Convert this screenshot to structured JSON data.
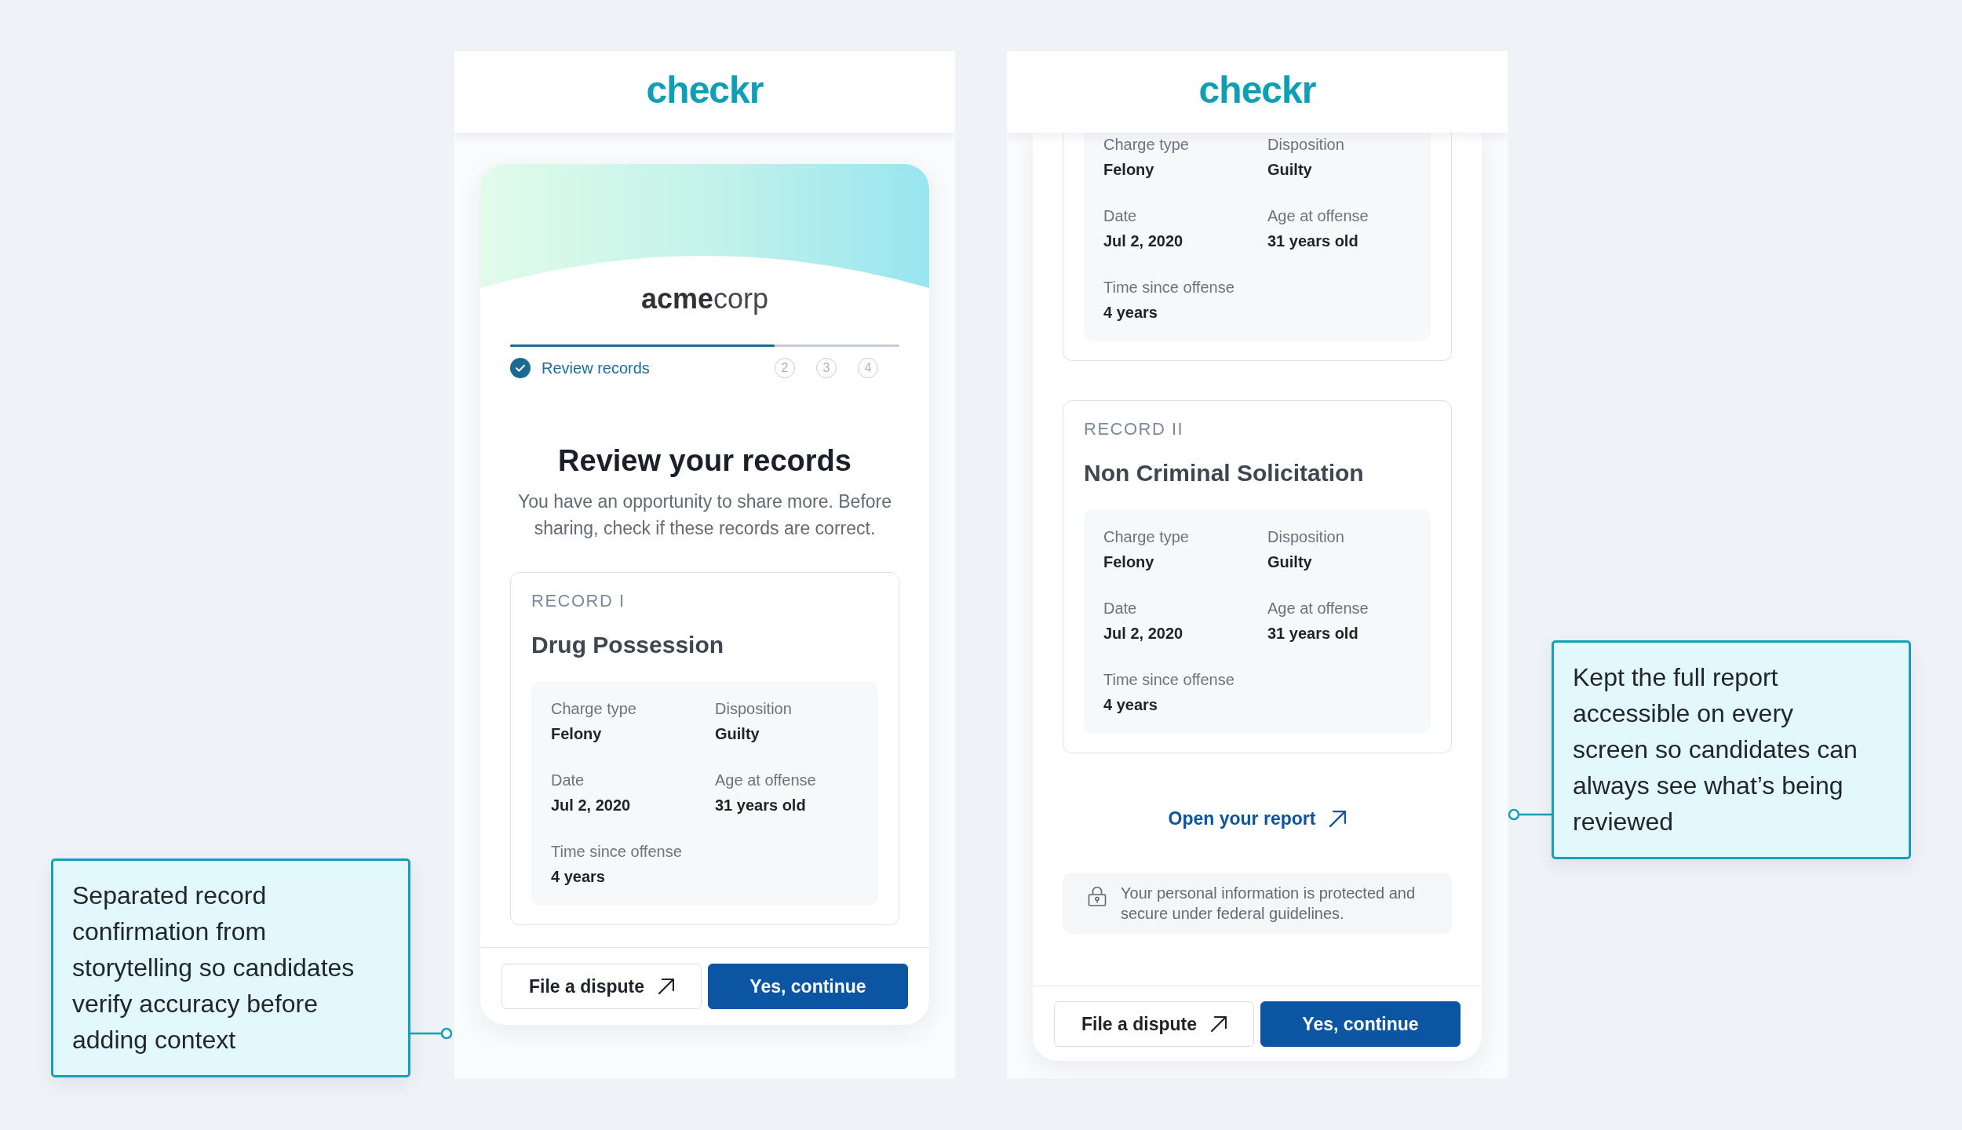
{
  "screens": [
    {
      "header": {
        "logo": "checkr"
      },
      "banner": {
        "company_logo": "**acme**corp"
      },
      "progress": {
        "level": 0.68
      },
      "steps": [
        {
          "label": "Review records",
          "completed": true
        },
        {
          "label": "2",
          "completed": false
        },
        {
          "label": "3",
          "completed": false
        },
        {
          "label": "4",
          "completed": false
        }
      ],
      "heading": "Review your records",
      "intro": "You have an opportunity to share more. Before sharing, check if these records are correct.",
      "records": [
        {
          "label": "RECORD I",
          "title": "Drug Possession",
          "fields": [
            {
              "label": "Charge type",
              "value": "Felony"
            },
            {
              "label": "Disposition",
              "value": "Guilty"
            },
            {
              "label": "Date",
              "value": "Jul 2, 2020"
            },
            {
              "label": "Age at offense",
              "value": "31 years old"
            },
            {
              "label": "Time since offense",
              "value": "4 years"
            }
          ]
        }
      ],
      "footer_buttons": [
        {
          "kind": "external",
          "label": "File a dispute"
        },
        {
          "kind": "primary",
          "label": "Yes, continue"
        }
      ],
      "annotation": "Separated record confirmation from storytelling so candidates verify accuracy before adding context"
    },
    {
      "header": {
        "logo": "checkr"
      },
      "records": [
        {
          "fields": [
            {
              "label": "Charge type",
              "value": "Felony"
            },
            {
              "label": "Disposition",
              "value": "Guilty"
            },
            {
              "label": "Date",
              "value": "Jul 2, 2020"
            },
            {
              "label": "Age at offense",
              "value": "31 years old"
            },
            {
              "label": "Time since offense",
              "value": "4 years"
            }
          ]
        },
        {
          "label": "RECORD II",
          "title": "Non Criminal Solicitation",
          "fields": [
            {
              "label": "Charge type",
              "value": "Felony"
            },
            {
              "label": "Disposition",
              "value": "Guilty"
            },
            {
              "label": "Date",
              "value": "Jul 2, 2020"
            },
            {
              "label": "Age at offense",
              "value": "31 years old"
            },
            {
              "label": "Time since offense",
              "value": "4 years"
            }
          ]
        }
      ],
      "report_link": "Open your report",
      "privacy_note": "Your personal information is protected and secure under federal guidelines.",
      "footer_buttons": [
        {
          "kind": "external",
          "label": "File a dispute"
        },
        {
          "kind": "primary",
          "label": "Yes, continue"
        }
      ],
      "annotation": "Kept the full report accessible on every screen so candidates can always see what’s being reviewed"
    }
  ]
}
